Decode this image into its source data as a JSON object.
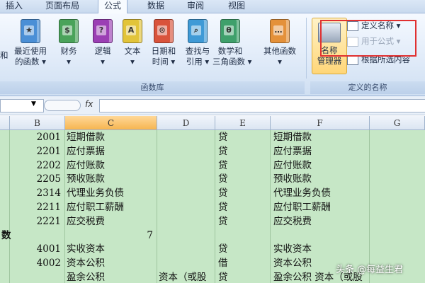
{
  "tabs": [
    "插入",
    "页面布局",
    "公式",
    "数据",
    "审阅",
    "视图"
  ],
  "ribbon": {
    "function_library": {
      "label": "函数库",
      "buttons": [
        {
          "id": "recent",
          "line1": "最近使用",
          "line2": "的函数 ▾",
          "color": "#4a8fd6",
          "glyph": "★"
        },
        {
          "id": "financial",
          "line1": "财务",
          "line2": "▾",
          "color": "#4aa35a",
          "glyph": "$"
        },
        {
          "id": "logical",
          "line1": "逻辑",
          "line2": "▾",
          "color": "#9b3fb4",
          "glyph": "?"
        },
        {
          "id": "text",
          "line1": "文本",
          "line2": "▾",
          "color": "#e2c43a",
          "glyph": "A"
        },
        {
          "id": "datetime",
          "line1": "日期和",
          "line2": "时间 ▾",
          "color": "#d9533b",
          "glyph": "⊙"
        },
        {
          "id": "lookup",
          "line1": "查找与",
          "line2": "引用 ▾",
          "color": "#3f9ad6",
          "glyph": "⌕"
        },
        {
          "id": "mathtrig",
          "line1": "数学和",
          "line2": "三角函数 ▾",
          "color": "#3fa06b",
          "glyph": "θ"
        },
        {
          "id": "more",
          "line1": "其他函数",
          "line2": "▾",
          "color": "#e4913a",
          "glyph": "…"
        }
      ],
      "edge_label": "和"
    },
    "defined_names": {
      "label": "定义的名称",
      "name_manager_line1": "名称",
      "name_manager_line2": "管理器",
      "define_name": "定义名称 ▾",
      "use_in_formula": "用于公式 ▾",
      "create_from_selection": "根据所选内容"
    }
  },
  "formula_bar": {
    "fx": "fx",
    "value": ""
  },
  "columns": [
    "B",
    "C",
    "D",
    "E",
    "F",
    "G"
  ],
  "rows": [
    {
      "b": "2001",
      "c": "短期借款",
      "d": "",
      "e": "贷",
      "f": "短期借款"
    },
    {
      "b": "2201",
      "c": "应付票据",
      "d": "",
      "e": "贷",
      "f": "应付票据"
    },
    {
      "b": "2202",
      "c": "应付账款",
      "d": "",
      "e": "贷",
      "f": "应付账款"
    },
    {
      "b": "2205",
      "c": "预收账款",
      "d": "",
      "e": "贷",
      "f": "预收账款"
    },
    {
      "b": "2314",
      "c": "代理业务负债",
      "d": "",
      "e": "贷",
      "f": "代理业务负债"
    },
    {
      "b": "2211",
      "c": "应付职工薪酬",
      "d": "",
      "e": "贷",
      "f": "应付职工薪酬"
    },
    {
      "b": "2221",
      "c": "应交税费",
      "d": "",
      "e": "贷",
      "f": "应交税费"
    },
    {
      "a": "数",
      "b": "",
      "c": "",
      "c_num": "7",
      "d": "",
      "e": "",
      "f": ""
    },
    {
      "b": "4001",
      "c": "实收资本",
      "d": "",
      "e": "贷",
      "f": "实收资本"
    },
    {
      "b": "4002",
      "c": "资本公积",
      "d": "",
      "e": "借",
      "f": "资本公积"
    },
    {
      "b": "",
      "c": "盈余公积",
      "d": "资本（或股",
      "e": "贷",
      "f": "盈余公积  资本（或股"
    }
  ],
  "watermark": "头条 @每益生君"
}
